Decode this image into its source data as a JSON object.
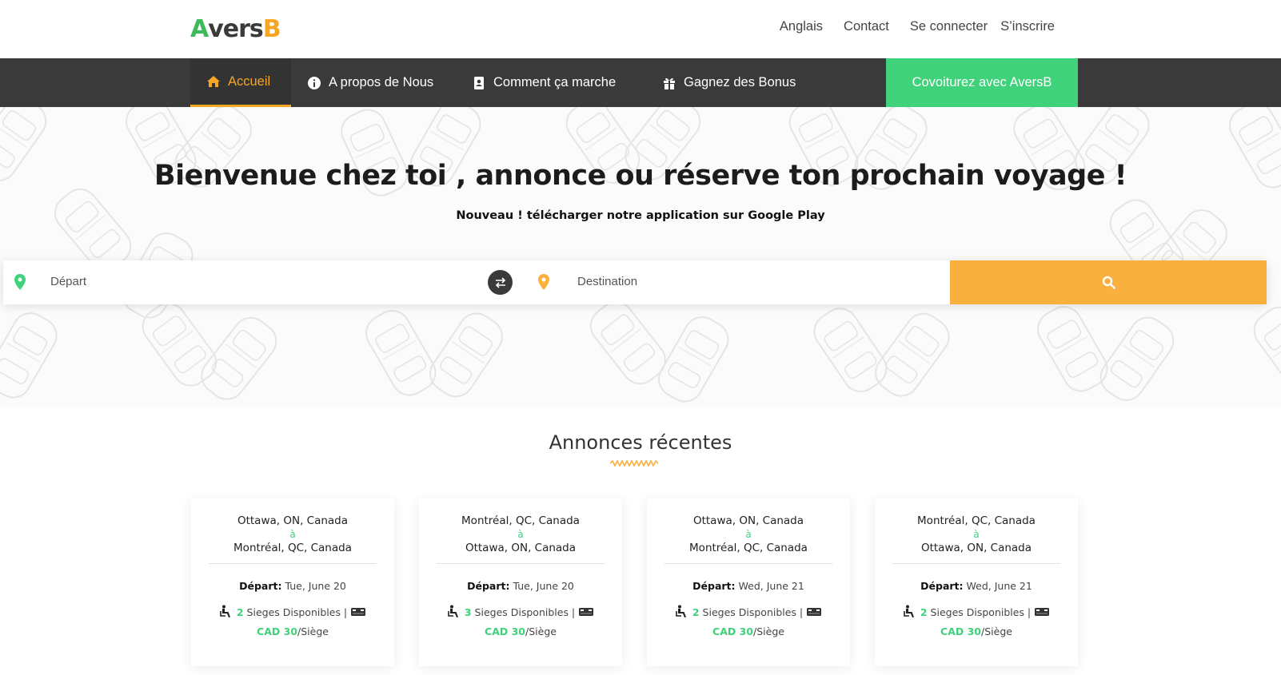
{
  "brand": {
    "logo_a": "A",
    "logo_vers": "vers",
    "logo_b": "B"
  },
  "toplinks": {
    "english": "Anglais",
    "contact": "Contact",
    "login": "Se connecter",
    "signup": "S’inscrire"
  },
  "nav": {
    "home": "Accueil",
    "about": "A propos de Nous",
    "how": "Comment ça marche",
    "bonus": "Gagnez des Bonus",
    "cta": "Covoiturez avec AversB"
  },
  "hero": {
    "title": "Bienvenue chez toi , annonce ou réserve ton prochain voyage !",
    "subtitle": "Nouveau ! télécharger notre application sur Google Play"
  },
  "search": {
    "departure_placeholder": "Départ",
    "destination_placeholder": "Destination"
  },
  "recent": {
    "title": "Annonces récentes",
    "cards": [
      {
        "from": "Ottawa, ON, Canada",
        "a": "à",
        "to": "Montréal, QC, Canada",
        "dep_label": "Départ:",
        "dep_date": "Tue, June 20",
        "seats_num": "2",
        "seats_text": "Sieges Disponibles |",
        "price": "CAD 30",
        "per": "/Siège"
      },
      {
        "from": "Montréal, QC, Canada",
        "a": "à",
        "to": "Ottawa, ON, Canada",
        "dep_label": "Départ:",
        "dep_date": "Tue, June 20",
        "seats_num": "3",
        "seats_text": "Sieges Disponibles |",
        "price": "CAD 30",
        "per": "/Siège"
      },
      {
        "from": "Ottawa, ON, Canada",
        "a": "à",
        "to": "Montréal, QC, Canada",
        "dep_label": "Départ:",
        "dep_date": "Wed, June 21",
        "seats_num": "2",
        "seats_text": "Sieges Disponibles |",
        "price": "CAD 30",
        "per": "/Siège"
      },
      {
        "from": "Montréal, QC, Canada",
        "a": "à",
        "to": "Ottawa, ON, Canada",
        "dep_label": "Départ:",
        "dep_date": "Wed, June 21",
        "seats_num": "2",
        "seats_text": "Sieges Disponibles |",
        "price": "CAD 30",
        "per": "/Siège"
      }
    ]
  },
  "colors": {
    "accent_orange": "#f9b03f",
    "accent_green": "#3fd27a",
    "nav_dark": "#3a3a3a"
  }
}
